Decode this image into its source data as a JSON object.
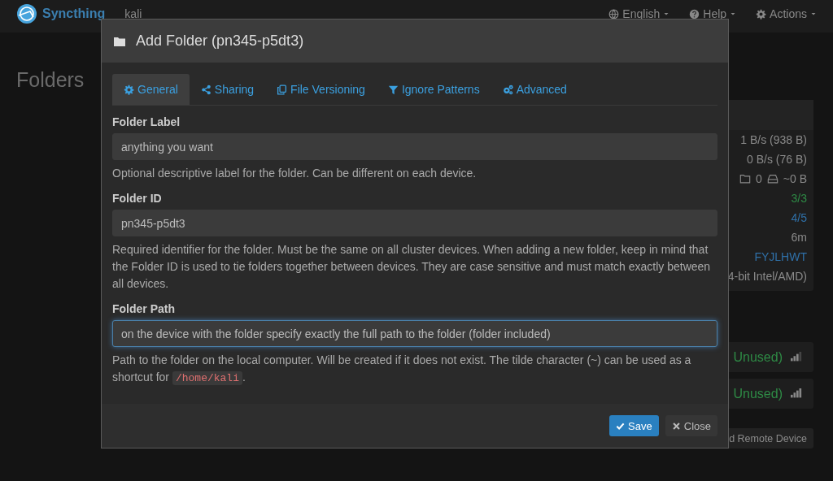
{
  "navbar": {
    "brand": "Syncthing",
    "device_name": "kali",
    "menus": [
      {
        "label": "English",
        "kind": "language"
      },
      {
        "label": "Help",
        "kind": "help"
      },
      {
        "label": "Actions",
        "kind": "actions"
      }
    ]
  },
  "page": {
    "heading": "Folders",
    "device_stats": [
      {
        "kind": "text",
        "value": "1 B/s (938 B)",
        "color": "#8a8a8a"
      },
      {
        "kind": "text",
        "value": "0 B/s (76 B)",
        "color": "#8a8a8a"
      },
      {
        "kind": "counts",
        "folders": "0",
        "size": "~0 B"
      },
      {
        "kind": "text",
        "value": "3/3",
        "color": "#2e8a45"
      },
      {
        "kind": "text",
        "value": "4/5",
        "color": "#2f70a8"
      },
      {
        "kind": "text",
        "value": "6m",
        "color": "#8a8a8a"
      },
      {
        "kind": "text",
        "value": "FYJLHWT",
        "color": "#2f70a8"
      },
      {
        "kind": "text",
        "value": "4-bit Intel/AMD)",
        "color": "#8a8a8a"
      }
    ],
    "devices": [
      {
        "status": "Unused)",
        "kind": "medium-signal"
      },
      {
        "status": "Unused)",
        "kind": "strong-signal"
      }
    ],
    "add_device_button": "d Remote Device"
  },
  "modal": {
    "title": "Add Folder (pn345-p5dt3)",
    "tabs": [
      {
        "label": "General",
        "selected": true
      },
      {
        "label": "Sharing",
        "selected": false
      },
      {
        "label": "File Versioning",
        "selected": false
      },
      {
        "label": "Ignore Patterns",
        "selected": false
      },
      {
        "label": "Advanced",
        "selected": false
      }
    ],
    "fields": [
      {
        "label": "Folder Label",
        "value": "anything you want",
        "focused": false,
        "help": [
          {
            "kind": "text",
            "text": "Optional descriptive label for the folder. Can be different on each device."
          }
        ]
      },
      {
        "label": "Folder ID",
        "value": "pn345-p5dt3",
        "focused": false,
        "help": [
          {
            "kind": "text",
            "text": "Required identifier for the folder. Must be the same on all cluster devices. When adding a new folder, keep in mind that the Folder ID is used to tie folders together between devices. They are case sensitive and must match exactly between all devices."
          }
        ]
      },
      {
        "label": "Folder Path",
        "value": "on the device with the folder specify exactly the full path to the folder (folder included)",
        "focused": true,
        "help": [
          {
            "kind": "text",
            "text": "Path to the folder on the local computer. Will be created if it does not exist. The tilde character (~) can be used as a shortcut for "
          },
          {
            "kind": "code",
            "text": "/home/kali"
          },
          {
            "kind": "text",
            "text": "."
          }
        ]
      }
    ],
    "buttons": [
      {
        "label": "Save",
        "kind": "primary"
      },
      {
        "label": "Close",
        "kind": "default"
      }
    ]
  }
}
